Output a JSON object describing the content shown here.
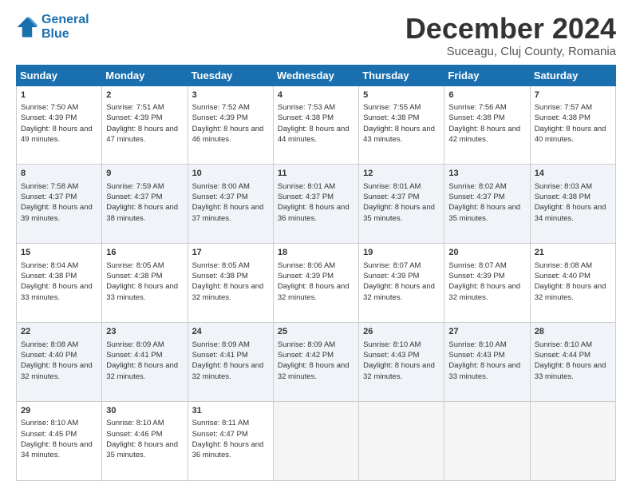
{
  "logo": {
    "line1": "General",
    "line2": "Blue"
  },
  "title": "December 2024",
  "subtitle": "Suceagu, Cluj County, Romania",
  "headers": [
    "Sunday",
    "Monday",
    "Tuesday",
    "Wednesday",
    "Thursday",
    "Friday",
    "Saturday"
  ],
  "weeks": [
    [
      {
        "day": "1",
        "sunrise": "Sunrise: 7:50 AM",
        "sunset": "Sunset: 4:39 PM",
        "daylight": "Daylight: 8 hours and 49 minutes."
      },
      {
        "day": "2",
        "sunrise": "Sunrise: 7:51 AM",
        "sunset": "Sunset: 4:39 PM",
        "daylight": "Daylight: 8 hours and 47 minutes."
      },
      {
        "day": "3",
        "sunrise": "Sunrise: 7:52 AM",
        "sunset": "Sunset: 4:39 PM",
        "daylight": "Daylight: 8 hours and 46 minutes."
      },
      {
        "day": "4",
        "sunrise": "Sunrise: 7:53 AM",
        "sunset": "Sunset: 4:38 PM",
        "daylight": "Daylight: 8 hours and 44 minutes."
      },
      {
        "day": "5",
        "sunrise": "Sunrise: 7:55 AM",
        "sunset": "Sunset: 4:38 PM",
        "daylight": "Daylight: 8 hours and 43 minutes."
      },
      {
        "day": "6",
        "sunrise": "Sunrise: 7:56 AM",
        "sunset": "Sunset: 4:38 PM",
        "daylight": "Daylight: 8 hours and 42 minutes."
      },
      {
        "day": "7",
        "sunrise": "Sunrise: 7:57 AM",
        "sunset": "Sunset: 4:38 PM",
        "daylight": "Daylight: 8 hours and 40 minutes."
      }
    ],
    [
      {
        "day": "8",
        "sunrise": "Sunrise: 7:58 AM",
        "sunset": "Sunset: 4:37 PM",
        "daylight": "Daylight: 8 hours and 39 minutes."
      },
      {
        "day": "9",
        "sunrise": "Sunrise: 7:59 AM",
        "sunset": "Sunset: 4:37 PM",
        "daylight": "Daylight: 8 hours and 38 minutes."
      },
      {
        "day": "10",
        "sunrise": "Sunrise: 8:00 AM",
        "sunset": "Sunset: 4:37 PM",
        "daylight": "Daylight: 8 hours and 37 minutes."
      },
      {
        "day": "11",
        "sunrise": "Sunrise: 8:01 AM",
        "sunset": "Sunset: 4:37 PM",
        "daylight": "Daylight: 8 hours and 36 minutes."
      },
      {
        "day": "12",
        "sunrise": "Sunrise: 8:01 AM",
        "sunset": "Sunset: 4:37 PM",
        "daylight": "Daylight: 8 hours and 35 minutes."
      },
      {
        "day": "13",
        "sunrise": "Sunrise: 8:02 AM",
        "sunset": "Sunset: 4:37 PM",
        "daylight": "Daylight: 8 hours and 35 minutes."
      },
      {
        "day": "14",
        "sunrise": "Sunrise: 8:03 AM",
        "sunset": "Sunset: 4:38 PM",
        "daylight": "Daylight: 8 hours and 34 minutes."
      }
    ],
    [
      {
        "day": "15",
        "sunrise": "Sunrise: 8:04 AM",
        "sunset": "Sunset: 4:38 PM",
        "daylight": "Daylight: 8 hours and 33 minutes."
      },
      {
        "day": "16",
        "sunrise": "Sunrise: 8:05 AM",
        "sunset": "Sunset: 4:38 PM",
        "daylight": "Daylight: 8 hours and 33 minutes."
      },
      {
        "day": "17",
        "sunrise": "Sunrise: 8:05 AM",
        "sunset": "Sunset: 4:38 PM",
        "daylight": "Daylight: 8 hours and 32 minutes."
      },
      {
        "day": "18",
        "sunrise": "Sunrise: 8:06 AM",
        "sunset": "Sunset: 4:39 PM",
        "daylight": "Daylight: 8 hours and 32 minutes."
      },
      {
        "day": "19",
        "sunrise": "Sunrise: 8:07 AM",
        "sunset": "Sunset: 4:39 PM",
        "daylight": "Daylight: 8 hours and 32 minutes."
      },
      {
        "day": "20",
        "sunrise": "Sunrise: 8:07 AM",
        "sunset": "Sunset: 4:39 PM",
        "daylight": "Daylight: 8 hours and 32 minutes."
      },
      {
        "day": "21",
        "sunrise": "Sunrise: 8:08 AM",
        "sunset": "Sunset: 4:40 PM",
        "daylight": "Daylight: 8 hours and 32 minutes."
      }
    ],
    [
      {
        "day": "22",
        "sunrise": "Sunrise: 8:08 AM",
        "sunset": "Sunset: 4:40 PM",
        "daylight": "Daylight: 8 hours and 32 minutes."
      },
      {
        "day": "23",
        "sunrise": "Sunrise: 8:09 AM",
        "sunset": "Sunset: 4:41 PM",
        "daylight": "Daylight: 8 hours and 32 minutes."
      },
      {
        "day": "24",
        "sunrise": "Sunrise: 8:09 AM",
        "sunset": "Sunset: 4:41 PM",
        "daylight": "Daylight: 8 hours and 32 minutes."
      },
      {
        "day": "25",
        "sunrise": "Sunrise: 8:09 AM",
        "sunset": "Sunset: 4:42 PM",
        "daylight": "Daylight: 8 hours and 32 minutes."
      },
      {
        "day": "26",
        "sunrise": "Sunrise: 8:10 AM",
        "sunset": "Sunset: 4:43 PM",
        "daylight": "Daylight: 8 hours and 32 minutes."
      },
      {
        "day": "27",
        "sunrise": "Sunrise: 8:10 AM",
        "sunset": "Sunset: 4:43 PM",
        "daylight": "Daylight: 8 hours and 33 minutes."
      },
      {
        "day": "28",
        "sunrise": "Sunrise: 8:10 AM",
        "sunset": "Sunset: 4:44 PM",
        "daylight": "Daylight: 8 hours and 33 minutes."
      }
    ],
    [
      {
        "day": "29",
        "sunrise": "Sunrise: 8:10 AM",
        "sunset": "Sunset: 4:45 PM",
        "daylight": "Daylight: 8 hours and 34 minutes."
      },
      {
        "day": "30",
        "sunrise": "Sunrise: 8:10 AM",
        "sunset": "Sunset: 4:46 PM",
        "daylight": "Daylight: 8 hours and 35 minutes."
      },
      {
        "day": "31",
        "sunrise": "Sunrise: 8:11 AM",
        "sunset": "Sunset: 4:47 PM",
        "daylight": "Daylight: 8 hours and 36 minutes."
      },
      null,
      null,
      null,
      null
    ]
  ]
}
